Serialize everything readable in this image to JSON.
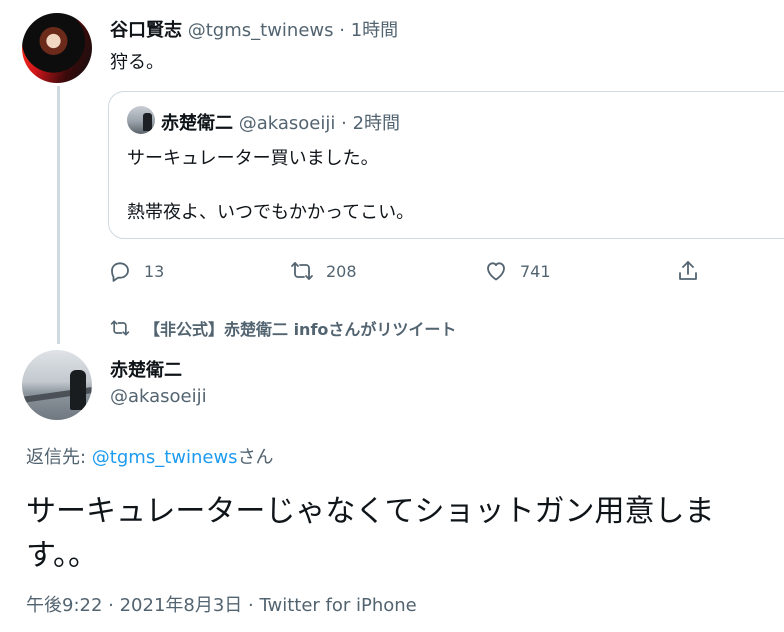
{
  "top_tweet": {
    "display_name": "谷口賢志",
    "handle": "@tgms_twinews",
    "separator": "·",
    "time": "1時間",
    "text": "狩る。"
  },
  "quoted_tweet": {
    "display_name": "赤楚衛二",
    "handle": "@akasoeiji",
    "separator": "·",
    "time": "2時間",
    "line1": "サーキュレーター買いました。",
    "line2": "熱帯夜よ、いつでもかかってこい。"
  },
  "actions": {
    "reply_icon": "reply-icon",
    "reply_count": "13",
    "retweet_icon": "retweet-icon",
    "retweet_count": "208",
    "like_icon": "heart-icon",
    "like_count": "741",
    "share_icon": "share-icon"
  },
  "retweet_context": {
    "icon": "retweet-icon",
    "text": "【非公式】赤楚衛二 infoさんがリツイート"
  },
  "main_tweet": {
    "display_name": "赤楚衛二",
    "handle": "@akasoeiji",
    "reply_prefix": "返信先: ",
    "reply_handle": "@tgms_twinews",
    "reply_suffix": "さん",
    "text": "サーキュレーターじゃなくてショットガン用意します。。",
    "timestamp": "午後9:22 · 2021年8月3日 · Twitter for iPhone"
  },
  "colors": {
    "text": "#0f1419",
    "secondary": "#536471",
    "link": "#1d9bf0",
    "border": "#cfd9de"
  }
}
